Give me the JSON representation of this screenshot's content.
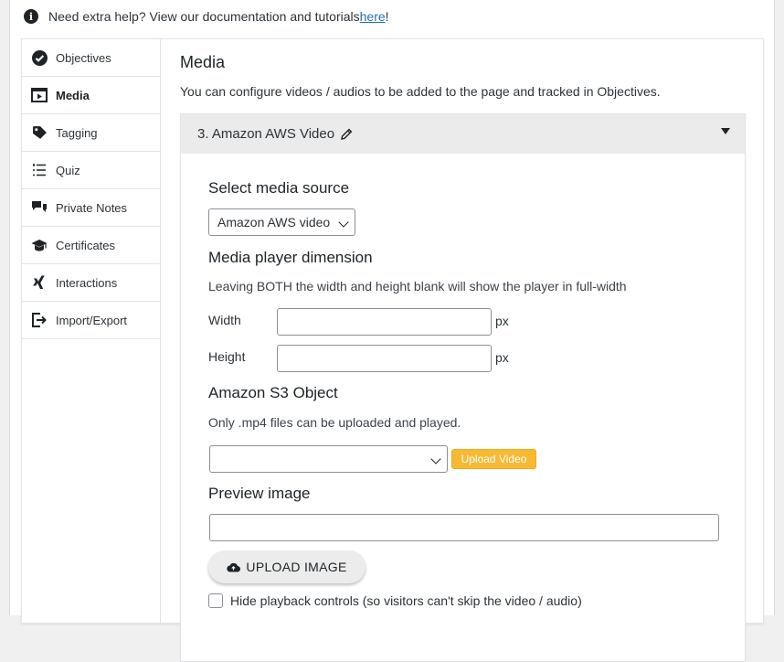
{
  "help": {
    "text": "Need extra help? View our documentation and tutorials ",
    "link": "here",
    "suffix": "!"
  },
  "sidebar": {
    "items": [
      {
        "label": "Objectives",
        "icon": "check-circle-icon",
        "active": false
      },
      {
        "label": "Media",
        "icon": "video-play-icon",
        "active": true
      },
      {
        "label": "Tagging",
        "icon": "tag-icon",
        "active": false
      },
      {
        "label": "Quiz",
        "icon": "list-icon",
        "active": false
      },
      {
        "label": "Private Notes",
        "icon": "chat-bubbles-icon",
        "active": false
      },
      {
        "label": "Certificates",
        "icon": "graduation-cap-icon",
        "active": false
      },
      {
        "label": "Interactions",
        "icon": "xing-icon",
        "active": false
      },
      {
        "label": "Import/Export",
        "icon": "export-icon",
        "active": false
      }
    ]
  },
  "main": {
    "title": "Media",
    "description": "You can configure videos / audios to be added to the page and tracked in Objectives."
  },
  "accordion": {
    "title": "3. Amazon AWS Video"
  },
  "form": {
    "source_title": "Select media source",
    "source_value": "Amazon AWS video",
    "dimension_title": "Media player dimension",
    "dimension_help": "Leaving BOTH the width and height blank will show the player in full-width",
    "width_label": "Width",
    "width_value": "",
    "height_label": "Height",
    "height_value": "",
    "unit": "px",
    "s3_title": "Amazon S3 Object",
    "s3_help": "Only .mp4 files can be uploaded and played.",
    "s3_value": "",
    "upload_video_label": "Upload Video",
    "preview_title": "Preview image",
    "preview_value": "",
    "upload_image_label": "UPLOAD IMAGE",
    "hide_controls_label": "Hide playback controls (so visitors can't skip the video / audio)",
    "hide_controls_checked": false
  },
  "colors": {
    "accent_upload": "#f7b934",
    "link": "#2271b1",
    "header_bg": "#ebebeb"
  }
}
